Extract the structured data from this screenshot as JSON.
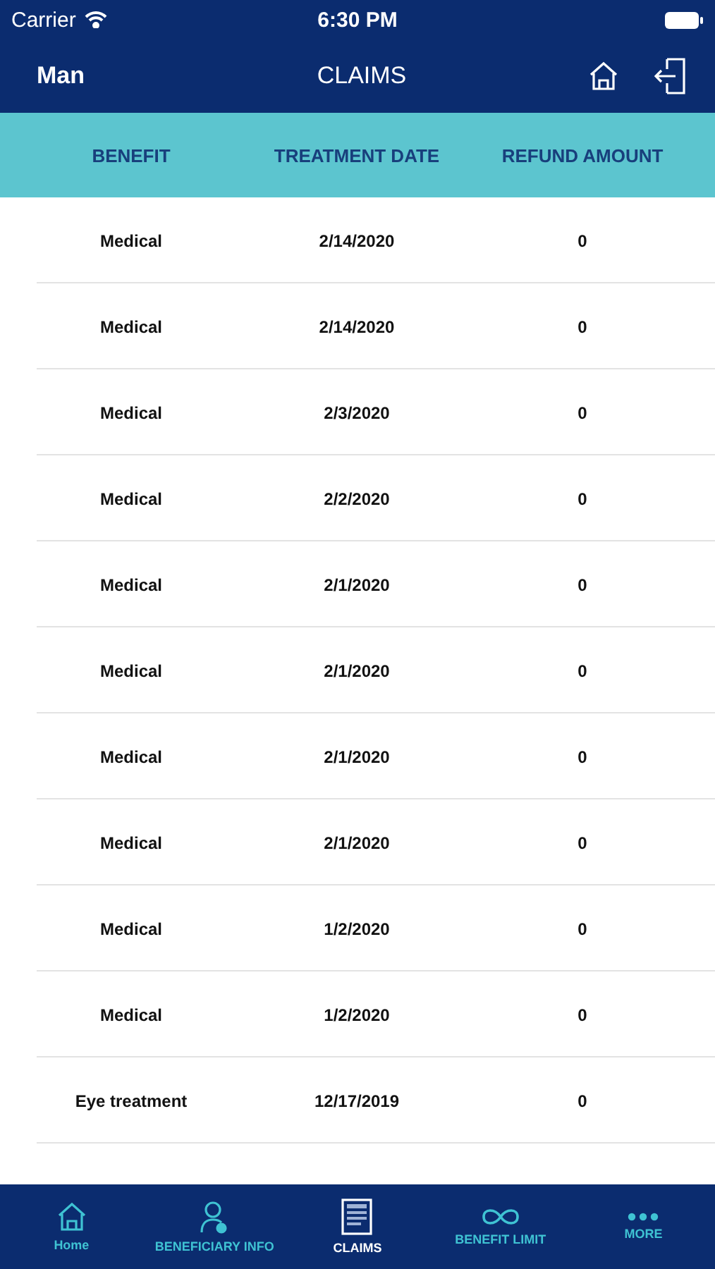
{
  "status_bar": {
    "carrier": "Carrier",
    "time": "6:30 PM"
  },
  "nav_bar": {
    "user": "Man",
    "title": "CLAIMS"
  },
  "table": {
    "columns": [
      "BENEFIT",
      "TREATMENT DATE",
      "REFUND AMOUNT"
    ],
    "rows": [
      [
        "Medical",
        "2/14/2020",
        "0"
      ],
      [
        "Medical",
        "2/14/2020",
        "0"
      ],
      [
        "Medical",
        "2/3/2020",
        "0"
      ],
      [
        "Medical",
        "2/2/2020",
        "0"
      ],
      [
        "Medical",
        "2/1/2020",
        "0"
      ],
      [
        "Medical",
        "2/1/2020",
        "0"
      ],
      [
        "Medical",
        "2/1/2020",
        "0"
      ],
      [
        "Medical",
        "2/1/2020",
        "0"
      ],
      [
        "Medical",
        "1/2/2020",
        "0"
      ],
      [
        "Medical",
        "1/2/2020",
        "0"
      ],
      [
        "Eye treatment",
        "12/17/2019",
        "0"
      ]
    ]
  },
  "tab_bar": [
    {
      "label": "Home",
      "kind": "home",
      "selected": false
    },
    {
      "label": "BENEFICIARY INFO",
      "kind": "person",
      "selected": false
    },
    {
      "label": "CLAIMS",
      "kind": "claims",
      "selected": true
    },
    {
      "label": "BENEFIT LIMIT",
      "kind": "infinity",
      "selected": false
    },
    {
      "label": "MORE",
      "kind": "more",
      "selected": false
    }
  ]
}
